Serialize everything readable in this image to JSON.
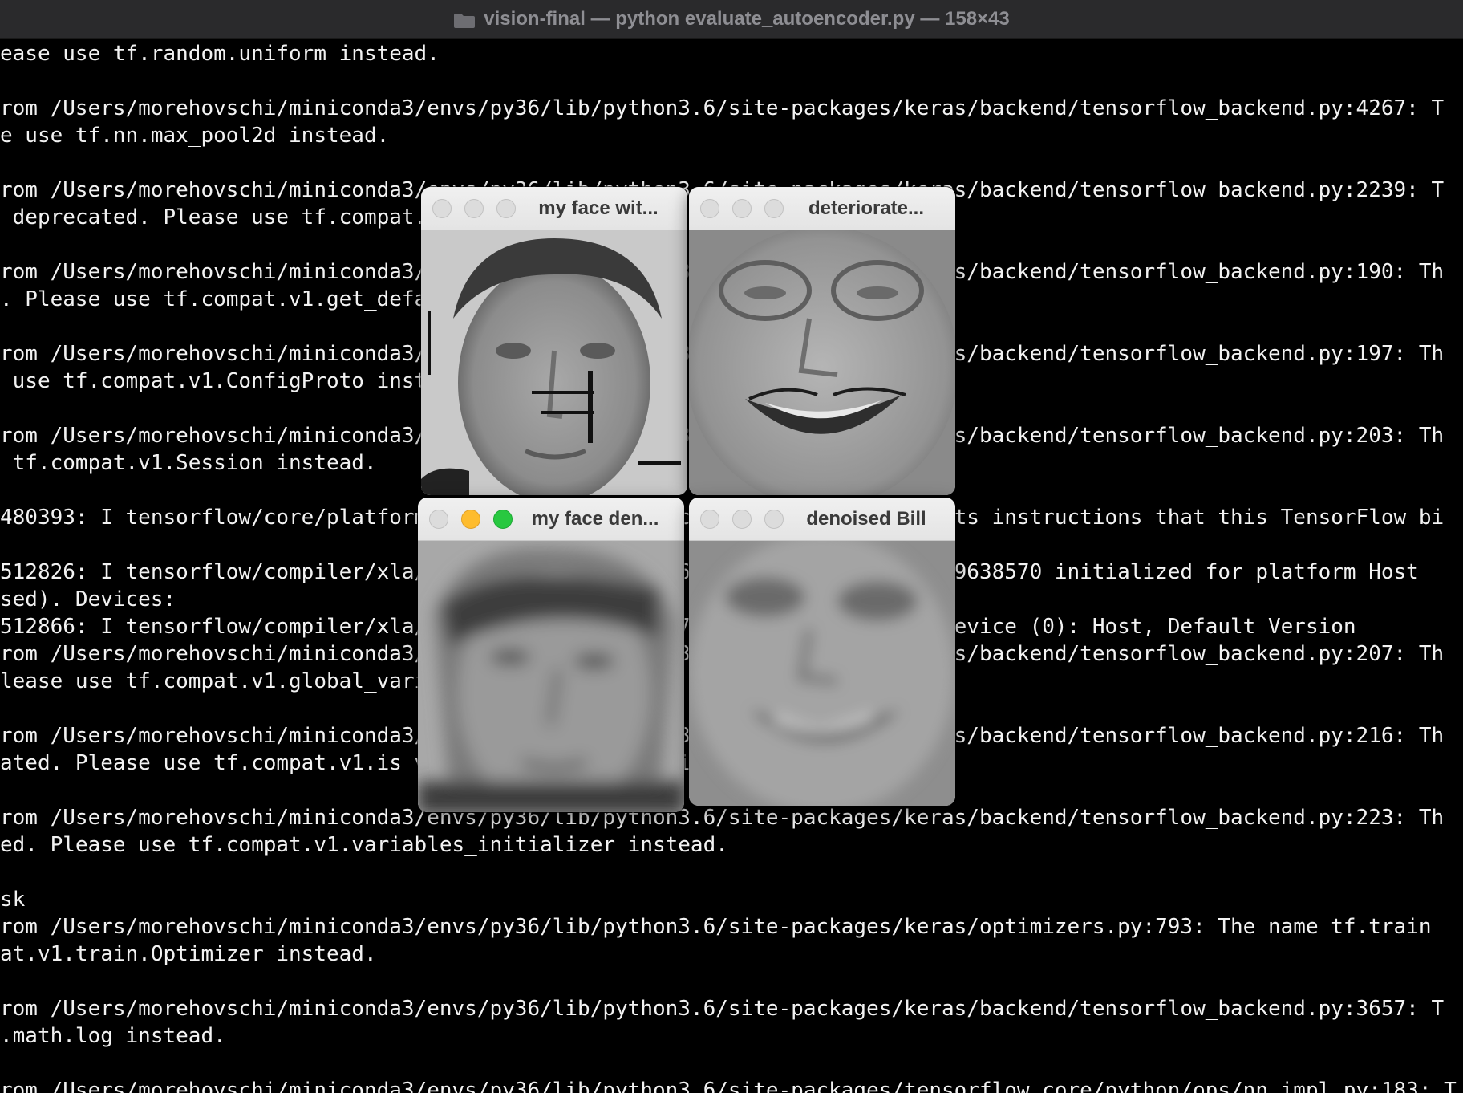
{
  "window": {
    "title": "vision-final — python evaluate_autoencoder.py — 158×43"
  },
  "terminal": {
    "lines": [
      "ease use tf.random.uniform instead.",
      "",
      "rom /Users/morehovschi/miniconda3/envs/py36/lib/python3.6/site-packages/keras/backend/tensorflow_backend.py:4267: T",
      "e use tf.nn.max_pool2d instead.",
      "",
      "rom /Users/morehovschi/miniconda3/envs/py36/lib/python3.6/site-packages/keras/backend/tensorflow_backend.py:2239: T",
      " deprecated. Please use tf.compat.v1.get_default_graph instead.",
      "",
      "rom /Users/morehovschi/miniconda3/envs/py36/lib/python3.6/site-packages/keras/backend/tensorflow_backend.py:190: Th",
      ". Please use tf.compat.v1.get_default_session instead.",
      "",
      "rom /Users/morehovschi/miniconda3/envs/py36/lib/python3.6/site-packages/keras/backend/tensorflow_backend.py:197: Th",
      " use tf.compat.v1.ConfigProto instead.",
      "",
      "rom /Users/morehovschi/miniconda3/envs/py36/lib/python3.6/site-packages/keras/backend/tensorflow_backend.py:203: Th",
      " tf.compat.v1.Session instead.",
      "",
      "480393: I tensorflow/core/platform/cpu_feature_guard.cc:142] Your CPU supports instructions that this TensorFlow bi",
      "",
      "512826: I tensorflow/compiler/xla/service/service.cc:168] XLA service 0x7fd79638570 initialized for platform Host",
      "sed). Devices:",
      "512866: I tensorflow/compiler/xla/service/service.cc:176]   StreamExecutor device (0): Host, Default Version",
      "rom /Users/morehovschi/miniconda3/envs/py36/lib/python3.6/site-packages/keras/backend/tensorflow_backend.py:207: Th",
      "lease use tf.compat.v1.global_variables instead.",
      "",
      "rom /Users/morehovschi/miniconda3/envs/py36/lib/python3.6/site-packages/keras/backend/tensorflow_backend.py:216: Th",
      "ated. Please use tf.compat.v1.is_variable_initialized instead.",
      "",
      "rom /Users/morehovschi/miniconda3/envs/py36/lib/python3.6/site-packages/keras/backend/tensorflow_backend.py:223: Th",
      "ed. Please use tf.compat.v1.variables_initializer instead.",
      "",
      "sk",
      "rom /Users/morehovschi/miniconda3/envs/py36/lib/python3.6/site-packages/keras/optimizers.py:793: The name tf.train",
      "at.v1.train.Optimizer instead.",
      "",
      "rom /Users/morehovschi/miniconda3/envs/py36/lib/python3.6/site-packages/keras/backend/tensorflow_backend.py:3657: T",
      ".math.log instead.",
      "",
      "rom /Users/morehovschi/miniconda3/envs/py36/lib/python3.6/site-packages/tensorflow_core/python/ops/nn_impl.py:183: T"
    ]
  },
  "image_windows": [
    {
      "title": "my face wit...",
      "image": "noisy face with black line scribbles"
    },
    {
      "title": "deteriorate...",
      "image": "deteriorated smiling face with glasses"
    },
    {
      "title": "my face den...",
      "image": "blurred denoised face"
    },
    {
      "title": "denoised Bill",
      "image": "blurred denoised smiling face"
    }
  ],
  "colors": {
    "terminal_bg": "#000000",
    "terminal_text": "#f2f2f2",
    "titlebar_bg": "#2a2a2c",
    "titlebar_text": "#8e8e93",
    "traffic_yellow": "#febc2e",
    "traffic_green": "#28c840"
  }
}
